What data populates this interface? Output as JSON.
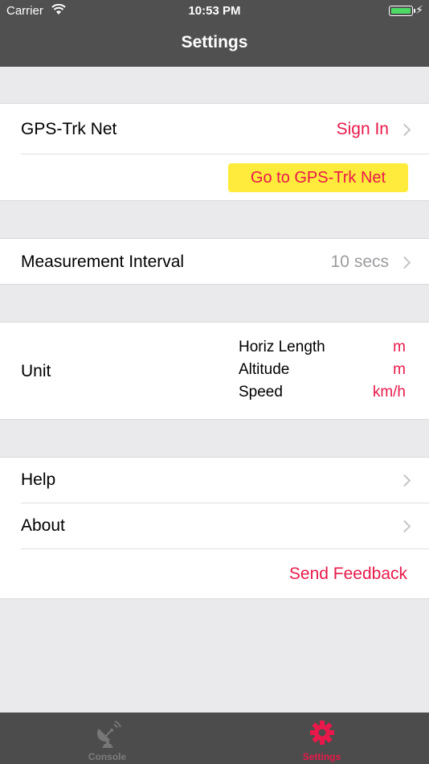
{
  "status": {
    "carrier": "Carrier",
    "time": "10:53 PM"
  },
  "nav": {
    "title": "Settings"
  },
  "account": {
    "label": "GPS-Trk Net",
    "action": "Sign In",
    "button": "Go to GPS-Trk Net"
  },
  "measurement": {
    "label": "Measurement Interval",
    "value": "10 secs"
  },
  "unit": {
    "label": "Unit",
    "items": [
      {
        "name": "Horiz Length",
        "value": "m"
      },
      {
        "name": "Altitude",
        "value": "m"
      },
      {
        "name": "Speed",
        "value": "km/h"
      }
    ]
  },
  "misc": {
    "help": "Help",
    "about": "About",
    "feedback": "Send Feedback"
  },
  "tabs": [
    {
      "label": "Console",
      "icon": "satellite-dish-icon",
      "active": false
    },
    {
      "label": "Settings",
      "icon": "gear-icon",
      "active": true
    }
  ],
  "colors": {
    "accent": "#e8194a",
    "button_bg": "#ffeb3b",
    "nav_bg": "#505050",
    "tab_bg": "#4c4c4c",
    "battery": "#4cd964"
  }
}
